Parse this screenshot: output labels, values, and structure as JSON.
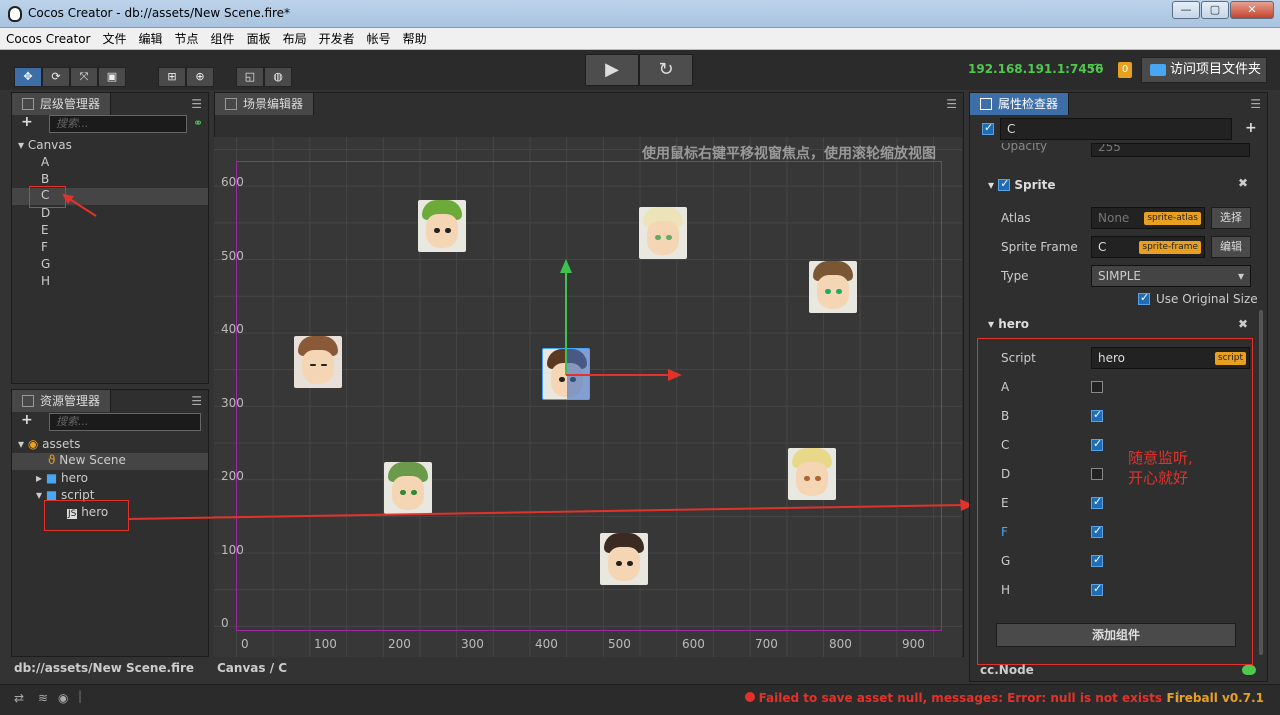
{
  "window": {
    "title": "Cocos Creator - db://assets/New Scene.fire*",
    "min": "—",
    "max": "▢",
    "close": "✕"
  },
  "menu": [
    "Cocos Creator",
    "文件",
    "编辑",
    "节点",
    "组件",
    "面板",
    "布局",
    "开发者",
    "帐号",
    "帮助"
  ],
  "toolbar": {
    "ip": "192.168.191.1:7456",
    "badge": "0",
    "open_folder": "访问项目文件夹"
  },
  "hierarchy": {
    "tab": "层级管理器",
    "search_placeholder": "搜索...",
    "root": "Canvas",
    "children": [
      "A",
      "B",
      "C",
      "D",
      "E",
      "F",
      "G",
      "H"
    ]
  },
  "assets": {
    "tab": "资源管理器",
    "search_placeholder": "搜索...",
    "root": "assets",
    "scene": "New Scene",
    "folder_hero": "hero",
    "folder_script": "script",
    "script_hero": "hero",
    "js_label": "JS",
    "status": "db://assets/New Scene.fire"
  },
  "scene": {
    "tab": "场景编辑器",
    "hint": "使用鼠标右键平移视窗焦点，使用滚轮缩放视图",
    "y_ticks": [
      "600",
      "500",
      "400",
      "300",
      "200",
      "100",
      "0"
    ],
    "x_ticks": [
      "0",
      "100",
      "200",
      "300",
      "400",
      "500",
      "600",
      "700",
      "800",
      "900"
    ],
    "status": "Canvas / C"
  },
  "inspector": {
    "tab": "属性检查器",
    "node_name": "C",
    "opacity_label": "Opacity",
    "opacity_value": "255",
    "sprite": {
      "title": "Sprite",
      "atlas_label": "Atlas",
      "atlas_value": "None",
      "atlas_tag": "sprite-atlas",
      "atlas_btn": "选择",
      "frame_label": "Sprite Frame",
      "frame_value": "C",
      "frame_tag": "sprite-frame",
      "frame_btn": "编辑",
      "type_label": "Type",
      "type_value": "SIMPLE",
      "use_original": "Use Original Size"
    },
    "hero": {
      "title": "hero",
      "script_label": "Script",
      "script_value": "hero",
      "script_tag": "script",
      "props": [
        {
          "name": "A",
          "checked": false
        },
        {
          "name": "B",
          "checked": true
        },
        {
          "name": "C",
          "checked": true
        },
        {
          "name": "D",
          "checked": false
        },
        {
          "name": "E",
          "checked": true
        },
        {
          "name": "F",
          "checked": true
        },
        {
          "name": "G",
          "checked": true
        },
        {
          "name": "H",
          "checked": true
        }
      ]
    },
    "note_line1": "随意监听,",
    "note_line2": "开心就好",
    "add_component": "添加组件",
    "status": "cc.Node"
  },
  "statusbar": {
    "error": "Failed to save asset null, messages: Error: null is not exists",
    "version": "Fireball v0.7.1"
  },
  "colors": {
    "accent": "#3d6ea8",
    "ip": "#4fc84f",
    "error": "#e3322b",
    "version": "#e8a021"
  }
}
